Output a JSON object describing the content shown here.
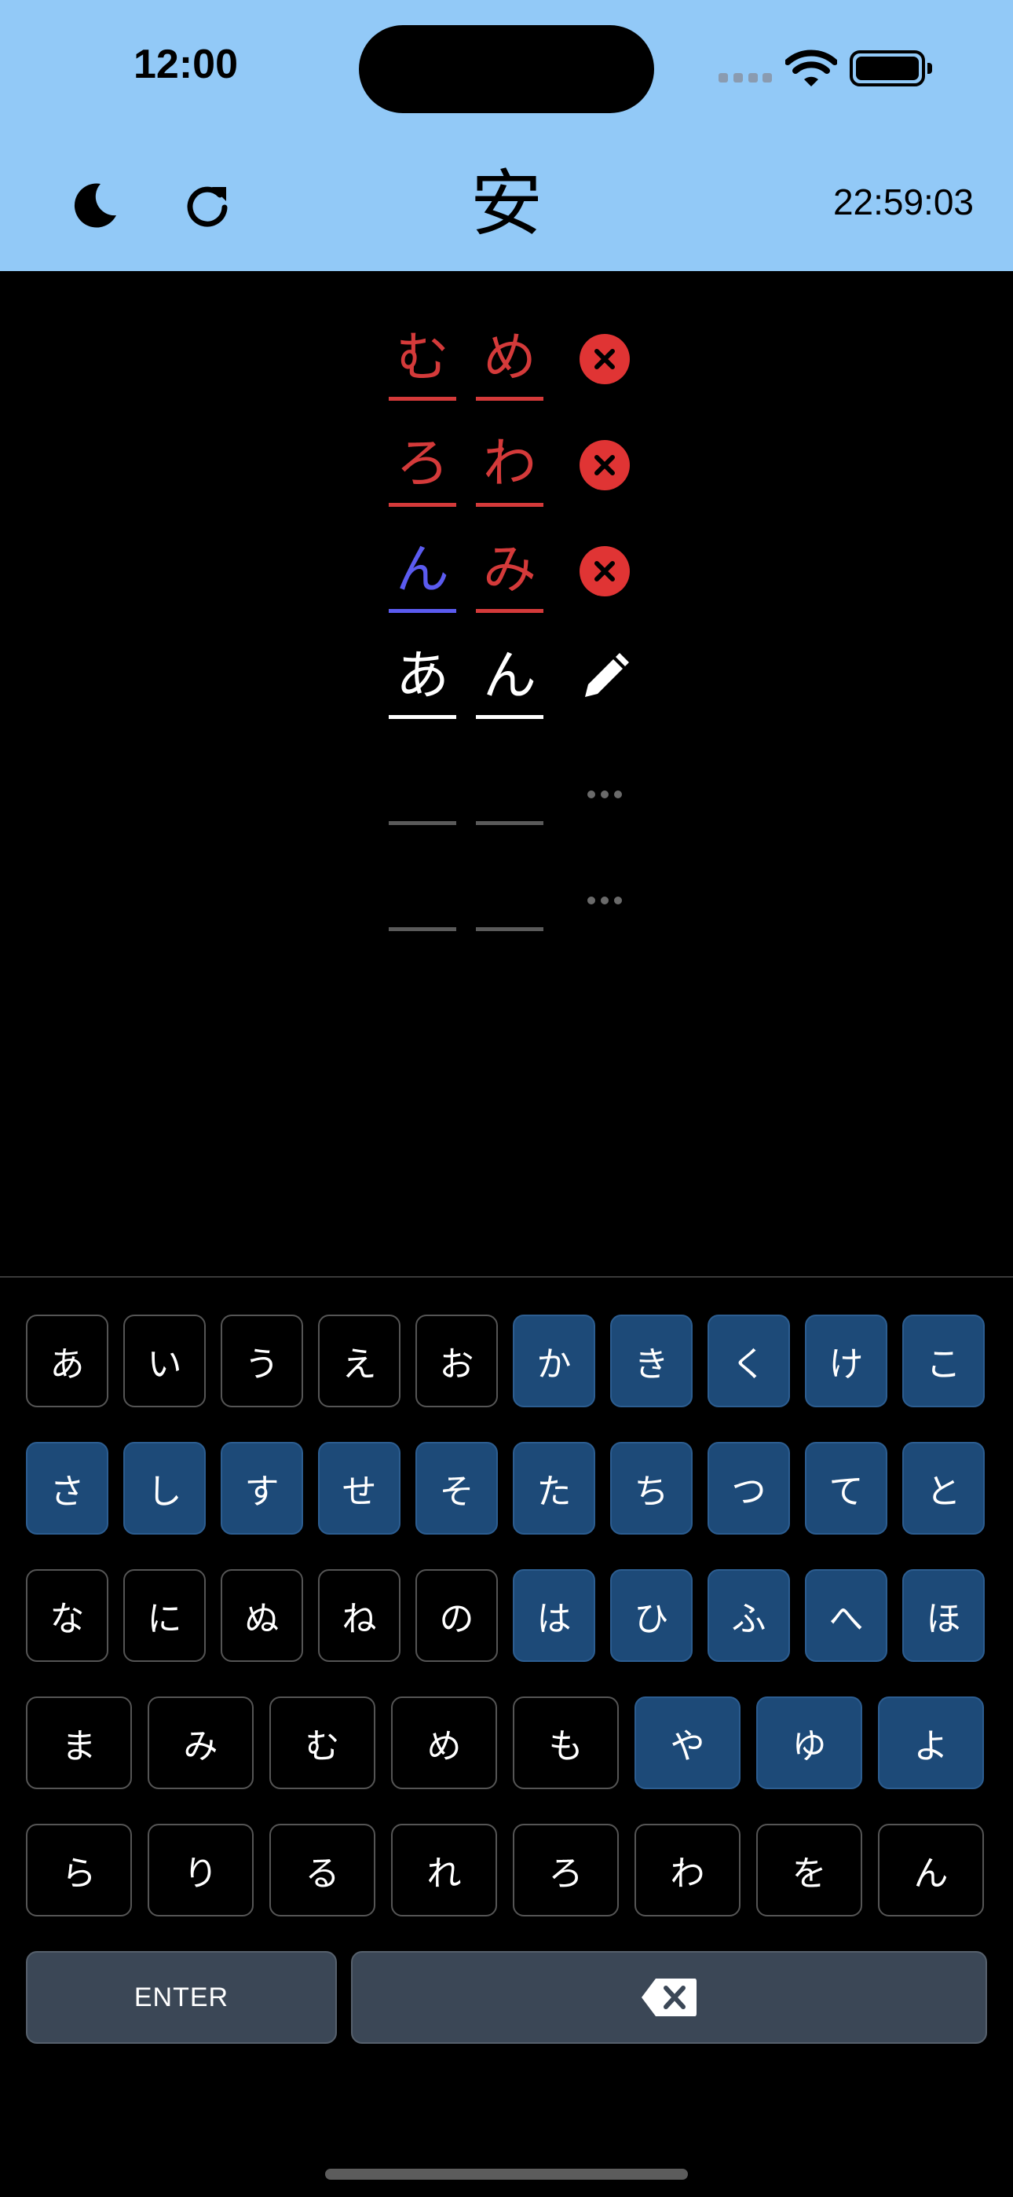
{
  "status_bar": {
    "time": "12:00"
  },
  "header": {
    "title": "安",
    "timer": "22:59:03",
    "theme_icon": "moon-icon",
    "refresh_icon": "refresh-icon"
  },
  "colors": {
    "header_bg": "#92c9f7",
    "wrong": "#d43a3a",
    "present": "#5b5bf0",
    "key_highlight": "#1d4a78",
    "action_key": "#3b4756"
  },
  "guesses": [
    {
      "chars": [
        "む",
        "め"
      ],
      "states": [
        "wrong",
        "wrong"
      ],
      "status_icon": "close-icon"
    },
    {
      "chars": [
        "ろ",
        "わ"
      ],
      "states": [
        "wrong",
        "wrong"
      ],
      "status_icon": "close-icon"
    },
    {
      "chars": [
        "ん",
        "み"
      ],
      "states": [
        "present",
        "wrong"
      ],
      "status_icon": "close-icon"
    },
    {
      "chars": [
        "あ",
        "ん"
      ],
      "states": [
        "typing",
        "typing"
      ],
      "status_icon": "pencil-icon"
    },
    {
      "chars": [
        "",
        ""
      ],
      "states": [
        "empty",
        "empty"
      ],
      "status_icon": "more-dots-icon"
    },
    {
      "chars": [
        "",
        ""
      ],
      "states": [
        "empty",
        "empty"
      ],
      "status_icon": "more-dots-icon"
    }
  ],
  "keyboard": {
    "rows": [
      [
        "あ",
        "い",
        "う",
        "え",
        "お",
        "か",
        "き",
        "く",
        "け",
        "こ"
      ],
      [
        "さ",
        "し",
        "す",
        "せ",
        "そ",
        "た",
        "ち",
        "つ",
        "て",
        "と"
      ],
      [
        "な",
        "に",
        "ぬ",
        "ね",
        "の",
        "は",
        "ひ",
        "ふ",
        "へ",
        "ほ"
      ],
      [
        "ま",
        "み",
        "む",
        "め",
        "も",
        "や",
        "ゆ",
        "よ"
      ],
      [
        "ら",
        "り",
        "る",
        "れ",
        "ろ",
        "わ",
        "を",
        "ん"
      ]
    ],
    "enter_label": "ENTER",
    "backspace_icon": "backspace-icon"
  }
}
